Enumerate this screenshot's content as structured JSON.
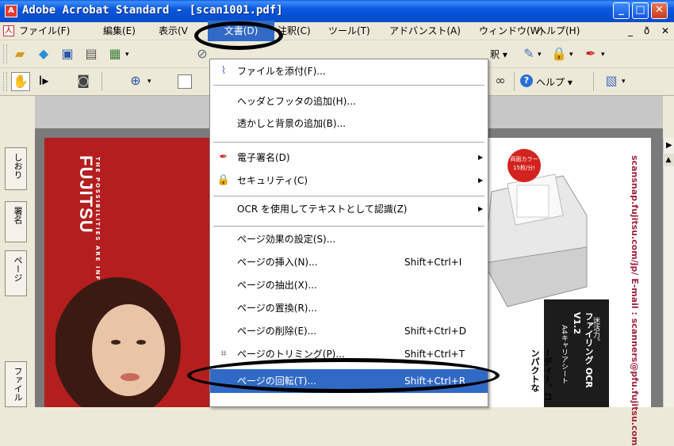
{
  "window": {
    "title": "Adobe Acrobat Standard - [scan1001.pdf]",
    "app_icon": "acrobat-icon",
    "controls": [
      "_",
      "□",
      "✕"
    ]
  },
  "menubar": {
    "file": "ファイル(F)",
    "edit": "編集(E)",
    "view": "表示(V",
    "document": "文書(D)",
    "comment": "注釈(C)",
    "tools": "ツール(T)",
    "advanced": "アドバンスト(A)",
    "window": "ウィンドウ(W)",
    "help": "ヘルプ(H)",
    "doc_controls": [
      "_",
      "ð",
      "✕"
    ]
  },
  "toolbar1": {
    "comment_dropdown": "注釈",
    "icons": [
      "open-folder-icon",
      "organizer-icon",
      "save-icon",
      "print-icon",
      "email-icon",
      "attach-icon",
      "comment-icon",
      "secure-icon",
      "sign-icon"
    ]
  },
  "toolbar2": {
    "help_label": "ヘルプ",
    "icons": [
      "hand-tool-icon",
      "select-text-icon",
      "snapshot-icon",
      "zoom-in-icon",
      "page-view-icon",
      "binoculars-icon",
      "help-icon",
      "extras-icon"
    ]
  },
  "left_nav": {
    "tabs": [
      "しおり",
      "署名",
      "ページ",
      "ファイル"
    ]
  },
  "document_menu": {
    "items": [
      {
        "label": "ファイルを添付(F)...",
        "icon": "paperclip-icon",
        "shortcut": "",
        "submenu": false
      },
      {
        "label": "ヘッダとフッタの追加(H)...",
        "shortcut": "",
        "submenu": false
      },
      {
        "label": "透かしと背景の追加(B)...",
        "shortcut": "",
        "submenu": false
      },
      {
        "label": "電子署名(D)",
        "icon": "pen-icon",
        "shortcut": "",
        "submenu": true
      },
      {
        "label": "セキュリティ(C)",
        "icon": "lock-icon",
        "shortcut": "",
        "submenu": true
      },
      {
        "label": "OCR を使用してテキストとして認識(Z)",
        "shortcut": "",
        "submenu": true
      },
      {
        "label": "ページ効果の設定(S)...",
        "shortcut": "",
        "submenu": false
      },
      {
        "label": "ページの挿入(N)...",
        "shortcut": "Shift+Ctrl+I",
        "submenu": false
      },
      {
        "label": "ページの抽出(X)...",
        "shortcut": "",
        "submenu": false
      },
      {
        "label": "ページの置換(R)...",
        "shortcut": "",
        "submenu": false
      },
      {
        "label": "ページの削除(E)...",
        "shortcut": "Shift+Ctrl+D",
        "submenu": false
      },
      {
        "label": "ページのトリミング(P)...",
        "icon": "crop-icon",
        "shortcut": "Shift+Ctrl+T",
        "submenu": false
      },
      {
        "label": "ページの回転(T)...",
        "shortcut": "Shift+Ctrl+R",
        "submenu": false,
        "highlighted": true
      }
    ]
  },
  "document_content": {
    "logo": "FUJITSU",
    "tagline": "THE POSSIBILITIES ARE INFINITE",
    "badge": "両面カラー 15枚/分!",
    "url_text": "scansnap.fujitsu.com/jp/ E-mail : scanners@pfu.fujitsu.com",
    "vertical_text_1": "ファイリング OCR V1.2",
    "vertical_text_2": "ーディー、コンパクトな",
    "vertical_text_3": "迷活力。",
    "vertical_text_4": "A4キャリアシート"
  },
  "colors": {
    "titlebar": "#0b58e0",
    "menu_highlight": "#316ac5",
    "page_red": "#b41e1e"
  }
}
